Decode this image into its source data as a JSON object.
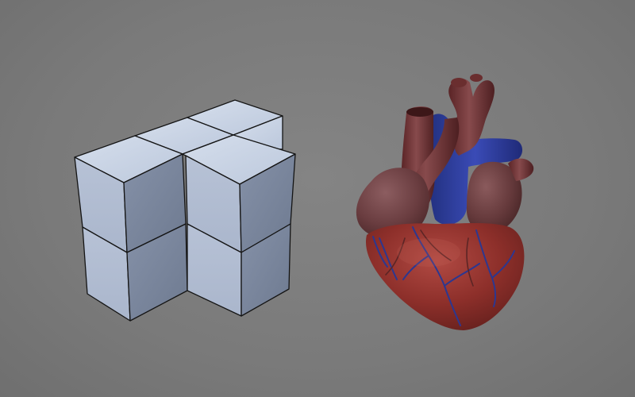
{
  "scene": {
    "background_color": "#7b7b7b",
    "objects": [
      {
        "name": "cube-cluster-model",
        "color": "#c4cfe0",
        "edge_color": "#111111"
      },
      {
        "name": "heart-model",
        "colors": {
          "muscle": "#8a2c28",
          "vessels_blue": "#2d3a9c",
          "vessels_maroon": "#6a2e2e"
        }
      }
    ]
  }
}
